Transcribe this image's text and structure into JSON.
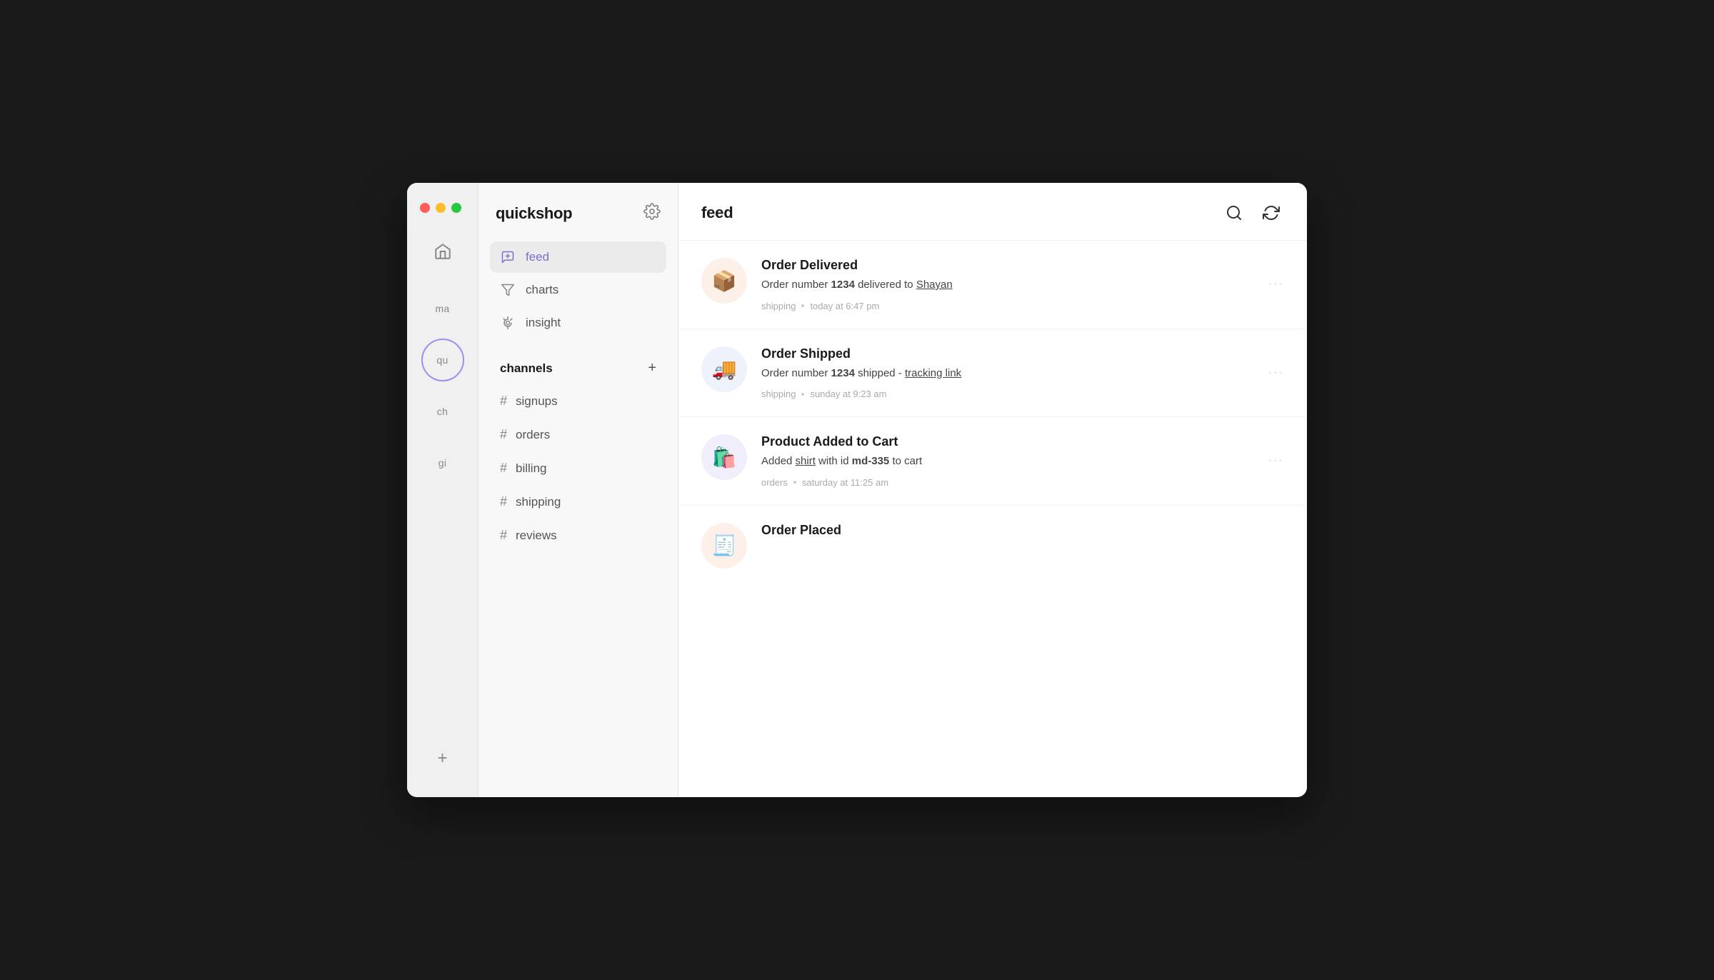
{
  "window": {
    "traffic_lights": [
      "red",
      "yellow",
      "green"
    ]
  },
  "icon_rail": {
    "home_label": "🏠",
    "workspace1_label": "ma",
    "workspace2_label": "qu",
    "workspace3_label": "ch",
    "workspace4_label": "gi",
    "add_label": "+"
  },
  "sidebar": {
    "title": "quickshop",
    "gear_label": "⚙",
    "nav_items": [
      {
        "id": "feed",
        "label": "feed",
        "active": true
      },
      {
        "id": "charts",
        "label": "charts",
        "active": false
      },
      {
        "id": "insight",
        "label": "insight",
        "active": false
      }
    ],
    "channels_section": {
      "title": "channels",
      "add_label": "+",
      "items": [
        {
          "id": "signups",
          "label": "signups"
        },
        {
          "id": "orders",
          "label": "orders"
        },
        {
          "id": "billing",
          "label": "billing"
        },
        {
          "id": "shipping",
          "label": "shipping"
        },
        {
          "id": "reviews",
          "label": "reviews"
        }
      ]
    }
  },
  "main": {
    "title": "feed",
    "search_icon": "search",
    "refresh_icon": "refresh",
    "feed_items": [
      {
        "id": "order-delivered",
        "icon_emoji": "📦",
        "icon_bg": "peach",
        "title": "Order Delivered",
        "description_parts": [
          {
            "type": "text",
            "value": "Order number "
          },
          {
            "type": "bold",
            "value": "1234"
          },
          {
            "type": "text",
            "value": " delivered to "
          },
          {
            "type": "underline",
            "value": "Shayan"
          }
        ],
        "meta_channel": "shipping",
        "meta_time": "today at 6:47 pm"
      },
      {
        "id": "order-shipped",
        "icon_emoji": "🚚",
        "icon_bg": "blue",
        "title": "Order Shipped",
        "description_parts": [
          {
            "type": "text",
            "value": "Order number "
          },
          {
            "type": "bold",
            "value": "1234"
          },
          {
            "type": "text",
            "value": " shipped - "
          },
          {
            "type": "underline",
            "value": "tracking link"
          }
        ],
        "meta_channel": "shipping",
        "meta_time": "sunday at 9:23 am"
      },
      {
        "id": "product-added-to-cart",
        "icon_emoji": "🛍️",
        "icon_bg": "purple",
        "title": "Product Added to Cart",
        "description_parts": [
          {
            "type": "text",
            "value": "Added "
          },
          {
            "type": "underline",
            "value": "shirt"
          },
          {
            "type": "text",
            "value": " with id "
          },
          {
            "type": "bold",
            "value": "md-335"
          },
          {
            "type": "text",
            "value": " to cart"
          }
        ],
        "meta_channel": "orders",
        "meta_time": "saturday at 11:25 am"
      },
      {
        "id": "order-placed",
        "icon_emoji": "🧾",
        "icon_bg": "peach",
        "title": "Order Placed",
        "description_parts": [],
        "meta_channel": "",
        "meta_time": ""
      }
    ]
  }
}
